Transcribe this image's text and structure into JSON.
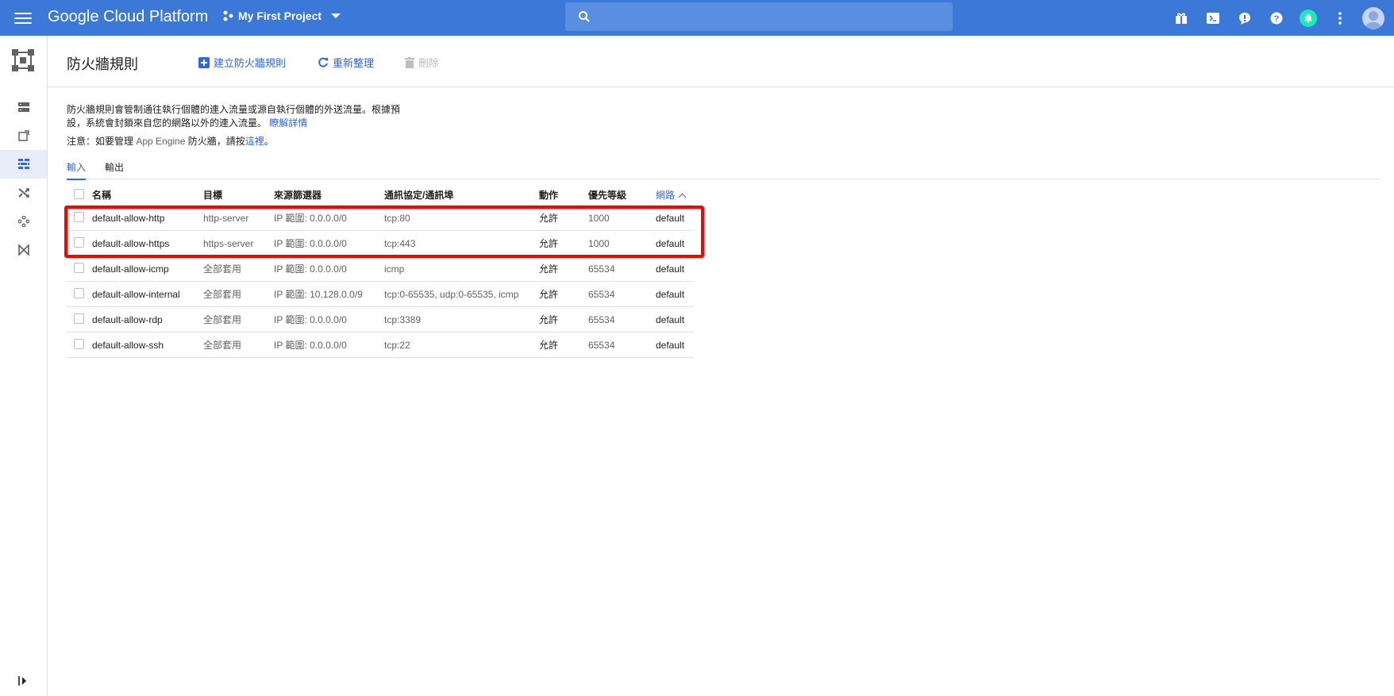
{
  "topbar": {
    "brand": "Google Cloud Platform",
    "project": "My First Project",
    "search_placeholder": "",
    "icons": [
      "gift-icon",
      "cloud-shell-icon",
      "feedback-icon",
      "help-icon",
      "notifications-icon",
      "more-vert-icon",
      "account-avatar"
    ]
  },
  "rail": {
    "logo": "vpc-network-logo",
    "items": [
      "vpc-networks",
      "external-ip",
      "firewall-rules",
      "routes",
      "vpc-peering",
      "network-connectivity"
    ],
    "active": "firewall-rules"
  },
  "header": {
    "title": "防火牆規則",
    "create_label": "建立防火牆規則",
    "refresh_label": "重新整理",
    "delete_label": "刪除"
  },
  "description": {
    "text": "防火牆規則會管制通往執行個體的連入流量或源自執行個體的外送流量。根據預設，系統會封鎖來自您的網路以外的連入流量。",
    "link": "瞭解詳情"
  },
  "note": {
    "prefix": "注意：如要管理",
    "mid": " App Engine ",
    "suffix": "防火牆，請按",
    "link": "這裡",
    "end": "。"
  },
  "tabs": [
    {
      "label": "輸入"
    },
    {
      "label": "輸出"
    }
  ],
  "table": {
    "columns": [
      "名稱",
      "目標",
      "來源篩選器",
      "通訊協定/通訊埠",
      "動作",
      "優先等級",
      "網路"
    ],
    "rows": [
      {
        "name": "default-allow-http",
        "target": "http-server",
        "source": "IP 範圍: 0.0.0.0/0",
        "proto": "tcp:80",
        "action": "允許",
        "priority": "1000",
        "network": "default"
      },
      {
        "name": "default-allow-https",
        "target": "https-server",
        "source": "IP 範圍: 0.0.0.0/0",
        "proto": "tcp:443",
        "action": "允許",
        "priority": "1000",
        "network": "default"
      },
      {
        "name": "default-allow-icmp",
        "target": "全部套用",
        "source": "IP 範圍: 0.0.0.0/0",
        "proto": "icmp",
        "action": "允許",
        "priority": "65534",
        "network": "default"
      },
      {
        "name": "default-allow-internal",
        "target": "全部套用",
        "source": "IP 範圍: 10.128.0.0/9",
        "proto": "tcp:0-65535, udp:0-65535, icmp",
        "action": "允許",
        "priority": "65534",
        "network": "default"
      },
      {
        "name": "default-allow-rdp",
        "target": "全部套用",
        "source": "IP 範圍: 0.0.0.0/0",
        "proto": "tcp:3389",
        "action": "允許",
        "priority": "65534",
        "network": "default"
      },
      {
        "name": "default-allow-ssh",
        "target": "全部套用",
        "source": "IP 範圍: 0.0.0.0/0",
        "proto": "tcp:22",
        "action": "允許",
        "priority": "65534",
        "network": "default"
      }
    ]
  },
  "colors": {
    "topbar": "#3c78d8",
    "accent": "#3367d6",
    "highlight": "#ff0000"
  }
}
